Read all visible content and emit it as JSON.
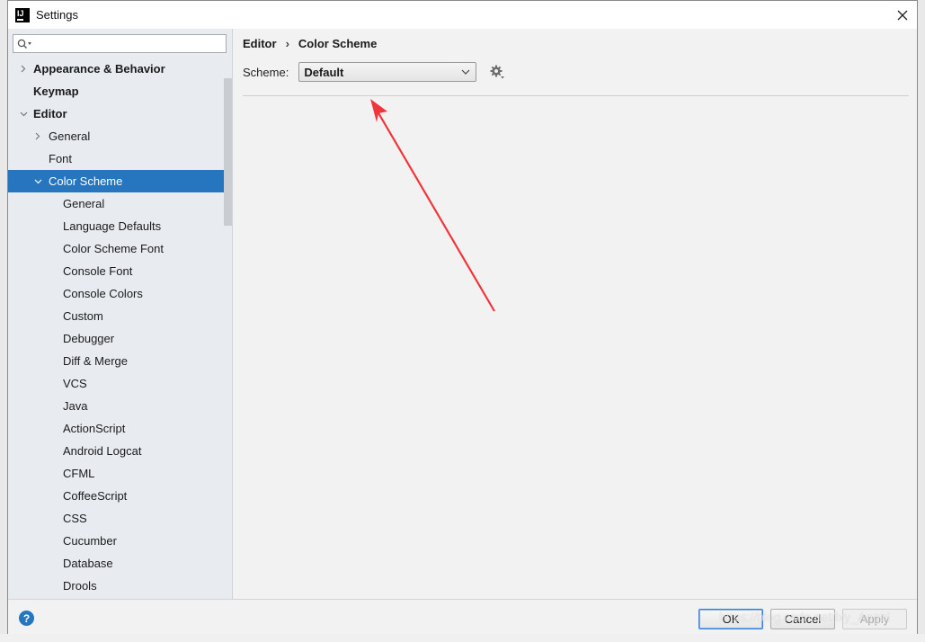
{
  "window": {
    "title": "Settings",
    "logo_text": "IJ"
  },
  "search": {
    "value": "",
    "placeholder": ""
  },
  "tree": {
    "items": [
      {
        "label": "Appearance & Behavior",
        "level": 0,
        "expandable": true,
        "expanded": false,
        "bold": true
      },
      {
        "label": "Keymap",
        "level": 0,
        "expandable": false,
        "bold": true
      },
      {
        "label": "Editor",
        "level": 0,
        "expandable": true,
        "expanded": true,
        "bold": true
      },
      {
        "label": "General",
        "level": 1,
        "expandable": true,
        "expanded": false
      },
      {
        "label": "Font",
        "level": 1,
        "expandable": false
      },
      {
        "label": "Color Scheme",
        "level": 1,
        "expandable": true,
        "expanded": true,
        "selected": true
      },
      {
        "label": "General",
        "level": 2
      },
      {
        "label": "Language Defaults",
        "level": 2
      },
      {
        "label": "Color Scheme Font",
        "level": 2
      },
      {
        "label": "Console Font",
        "level": 2
      },
      {
        "label": "Console Colors",
        "level": 2
      },
      {
        "label": "Custom",
        "level": 2
      },
      {
        "label": "Debugger",
        "level": 2
      },
      {
        "label": "Diff & Merge",
        "level": 2
      },
      {
        "label": "VCS",
        "level": 2
      },
      {
        "label": "Java",
        "level": 2
      },
      {
        "label": "ActionScript",
        "level": 2
      },
      {
        "label": "Android Logcat",
        "level": 2
      },
      {
        "label": "CFML",
        "level": 2
      },
      {
        "label": "CoffeeScript",
        "level": 2
      },
      {
        "label": "CSS",
        "level": 2
      },
      {
        "label": "Cucumber",
        "level": 2
      },
      {
        "label": "Database",
        "level": 2
      },
      {
        "label": "Drools",
        "level": 2
      }
    ]
  },
  "breadcrumb": {
    "parent": "Editor",
    "separator": "›",
    "current": "Color Scheme"
  },
  "scheme": {
    "label": "Scheme:",
    "value": "Default"
  },
  "footer": {
    "help": "?",
    "ok": "OK",
    "cancel": "Cancel",
    "apply": "Apply"
  },
  "watermark": "https://blog.csdn.net/lxy_Angel",
  "icons": {
    "search": "search-icon",
    "gear": "gear-icon",
    "close": "close-icon",
    "dropdown": "chevron-down-icon"
  },
  "colors": {
    "selection": "#2675bf",
    "annotation_arrow": "#f0363a",
    "left_panel_bg": "#e8ecf1",
    "dialog_bg": "#f2f2f2"
  }
}
